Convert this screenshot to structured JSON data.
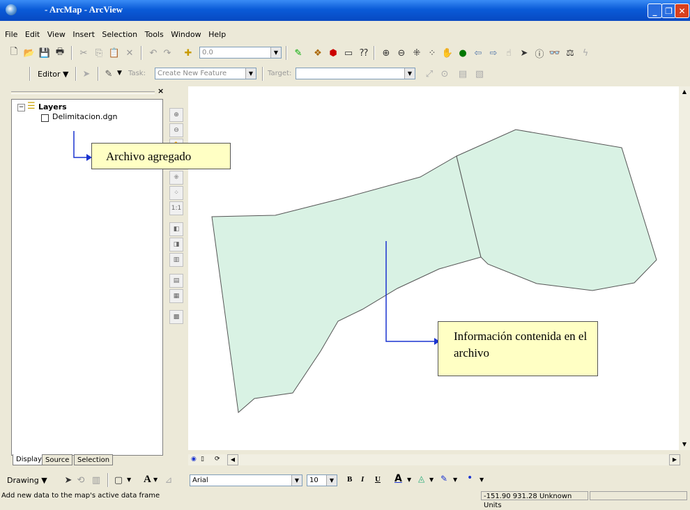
{
  "window": {
    "title": "- ArcMap - ArcView"
  },
  "menu": [
    "File",
    "Edit",
    "View",
    "Insert",
    "Selection",
    "Tools",
    "Window",
    "Help"
  ],
  "toolbar": {
    "scale_value": "0.0"
  },
  "editor": {
    "editor_label": "Editor",
    "task_label": "Task:",
    "task_value": "Create New Feature",
    "target_label": "Target:"
  },
  "toc": {
    "root_label": "Layers",
    "layer_label": "Delimitacion.dgn",
    "tabs": [
      "Display",
      "Source",
      "Selection"
    ]
  },
  "callouts": {
    "added_file": "Archivo agregado",
    "info_file": "Información contenida en el archivo"
  },
  "drawing": {
    "drawing_label": "Drawing",
    "font_name": "Arial",
    "font_size": "10",
    "bold": "B",
    "italic": "I",
    "underline": "U",
    "text_tool": "A"
  },
  "status": {
    "message": "Add new data to the map's active data frame",
    "coordinates": "-151.90  931.28 Unknown Units"
  },
  "colors": {
    "titlebar": "#0a5bd8",
    "polygon_fill": "#d9f2e4",
    "callout_fill": "#ffffc4",
    "arrow": "#1a33d0"
  }
}
